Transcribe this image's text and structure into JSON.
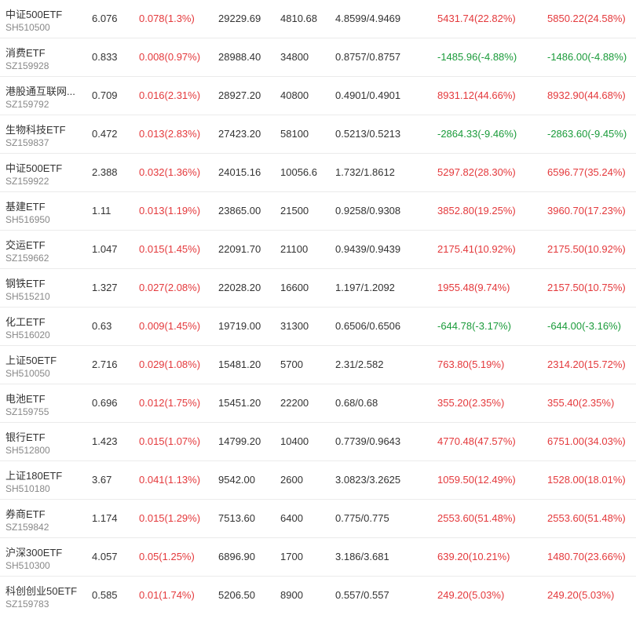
{
  "colors": {
    "up": "#e4393c",
    "down": "#1a9b3a",
    "text": "#333333",
    "code": "#888888",
    "divider": "#ebebeb"
  },
  "rows": [
    {
      "name": "中证500ETF",
      "code": "SH510500",
      "price": "6.076",
      "change": "0.078(1.3%)",
      "change_dir": "up",
      "market_value": "29229.69",
      "shares": "4810.68",
      "cost": "4.8599/4.9469",
      "float_pl": "5431.74(22.82%)",
      "float_dir": "up",
      "total_pl": "5850.22(24.58%)",
      "total_dir": "up"
    },
    {
      "name": "消费ETF",
      "code": "SZ159928",
      "price": "0.833",
      "change": "0.008(0.97%)",
      "change_dir": "up",
      "market_value": "28988.40",
      "shares": "34800",
      "cost": "0.8757/0.8757",
      "float_pl": "-1485.96(-4.88%)",
      "float_dir": "down",
      "total_pl": "-1486.00(-4.88%)",
      "total_dir": "down"
    },
    {
      "name": "港股通互联网...",
      "code": "SZ159792",
      "price": "0.709",
      "change": "0.016(2.31%)",
      "change_dir": "up",
      "market_value": "28927.20",
      "shares": "40800",
      "cost": "0.4901/0.4901",
      "float_pl": "8931.12(44.66%)",
      "float_dir": "up",
      "total_pl": "8932.90(44.68%)",
      "total_dir": "up"
    },
    {
      "name": "生物科技ETF",
      "code": "SZ159837",
      "price": "0.472",
      "change": "0.013(2.83%)",
      "change_dir": "up",
      "market_value": "27423.20",
      "shares": "58100",
      "cost": "0.5213/0.5213",
      "float_pl": "-2864.33(-9.46%)",
      "float_dir": "down",
      "total_pl": "-2863.60(-9.45%)",
      "total_dir": "down"
    },
    {
      "name": "中证500ETF",
      "code": "SZ159922",
      "price": "2.388",
      "change": "0.032(1.36%)",
      "change_dir": "up",
      "market_value": "24015.16",
      "shares": "10056.6",
      "cost": "1.732/1.8612",
      "float_pl": "5297.82(28.30%)",
      "float_dir": "up",
      "total_pl": "6596.77(35.24%)",
      "total_dir": "up"
    },
    {
      "name": "基建ETF",
      "code": "SH516950",
      "price": "1.11",
      "change": "0.013(1.19%)",
      "change_dir": "up",
      "market_value": "23865.00",
      "shares": "21500",
      "cost": "0.9258/0.9308",
      "float_pl": "3852.80(19.25%)",
      "float_dir": "up",
      "total_pl": "3960.70(17.23%)",
      "total_dir": "up"
    },
    {
      "name": "交运ETF",
      "code": "SZ159662",
      "price": "1.047",
      "change": "0.015(1.45%)",
      "change_dir": "up",
      "market_value": "22091.70",
      "shares": "21100",
      "cost": "0.9439/0.9439",
      "float_pl": "2175.41(10.92%)",
      "float_dir": "up",
      "total_pl": "2175.50(10.92%)",
      "total_dir": "up"
    },
    {
      "name": "钢铁ETF",
      "code": "SH515210",
      "price": "1.327",
      "change": "0.027(2.08%)",
      "change_dir": "up",
      "market_value": "22028.20",
      "shares": "16600",
      "cost": "1.197/1.2092",
      "float_pl": "1955.48(9.74%)",
      "float_dir": "up",
      "total_pl": "2157.50(10.75%)",
      "total_dir": "up"
    },
    {
      "name": "化工ETF",
      "code": "SH516020",
      "price": "0.63",
      "change": "0.009(1.45%)",
      "change_dir": "up",
      "market_value": "19719.00",
      "shares": "31300",
      "cost": "0.6506/0.6506",
      "float_pl": "-644.78(-3.17%)",
      "float_dir": "down",
      "total_pl": "-644.00(-3.16%)",
      "total_dir": "down"
    },
    {
      "name": "上证50ETF",
      "code": "SH510050",
      "price": "2.716",
      "change": "0.029(1.08%)",
      "change_dir": "up",
      "market_value": "15481.20",
      "shares": "5700",
      "cost": "2.31/2.582",
      "float_pl": "763.80(5.19%)",
      "float_dir": "up",
      "total_pl": "2314.20(15.72%)",
      "total_dir": "up"
    },
    {
      "name": "电池ETF",
      "code": "SZ159755",
      "price": "0.696",
      "change": "0.012(1.75%)",
      "change_dir": "up",
      "market_value": "15451.20",
      "shares": "22200",
      "cost": "0.68/0.68",
      "float_pl": "355.20(2.35%)",
      "float_dir": "up",
      "total_pl": "355.40(2.35%)",
      "total_dir": "up"
    },
    {
      "name": "银行ETF",
      "code": "SH512800",
      "price": "1.423",
      "change": "0.015(1.07%)",
      "change_dir": "up",
      "market_value": "14799.20",
      "shares": "10400",
      "cost": "0.7739/0.9643",
      "float_pl": "4770.48(47.57%)",
      "float_dir": "up",
      "total_pl": "6751.00(34.03%)",
      "total_dir": "up"
    },
    {
      "name": "上证180ETF",
      "code": "SH510180",
      "price": "3.67",
      "change": "0.041(1.13%)",
      "change_dir": "up",
      "market_value": "9542.00",
      "shares": "2600",
      "cost": "3.0823/3.2625",
      "float_pl": "1059.50(12.49%)",
      "float_dir": "up",
      "total_pl": "1528.00(18.01%)",
      "total_dir": "up"
    },
    {
      "name": "券商ETF",
      "code": "SZ159842",
      "price": "1.174",
      "change": "0.015(1.29%)",
      "change_dir": "up",
      "market_value": "7513.60",
      "shares": "6400",
      "cost": "0.775/0.775",
      "float_pl": "2553.60(51.48%)",
      "float_dir": "up",
      "total_pl": "2553.60(51.48%)",
      "total_dir": "up"
    },
    {
      "name": "沪深300ETF",
      "code": "SH510300",
      "price": "4.057",
      "change": "0.05(1.25%)",
      "change_dir": "up",
      "market_value": "6896.90",
      "shares": "1700",
      "cost": "3.186/3.681",
      "float_pl": "639.20(10.21%)",
      "float_dir": "up",
      "total_pl": "1480.70(23.66%)",
      "total_dir": "up"
    },
    {
      "name": "科创创业50ETF",
      "code": "SZ159783",
      "price": "0.585",
      "change": "0.01(1.74%)",
      "change_dir": "up",
      "market_value": "5206.50",
      "shares": "8900",
      "cost": "0.557/0.557",
      "float_pl": "249.20(5.03%)",
      "float_dir": "up",
      "total_pl": "249.20(5.03%)",
      "total_dir": "up"
    }
  ]
}
